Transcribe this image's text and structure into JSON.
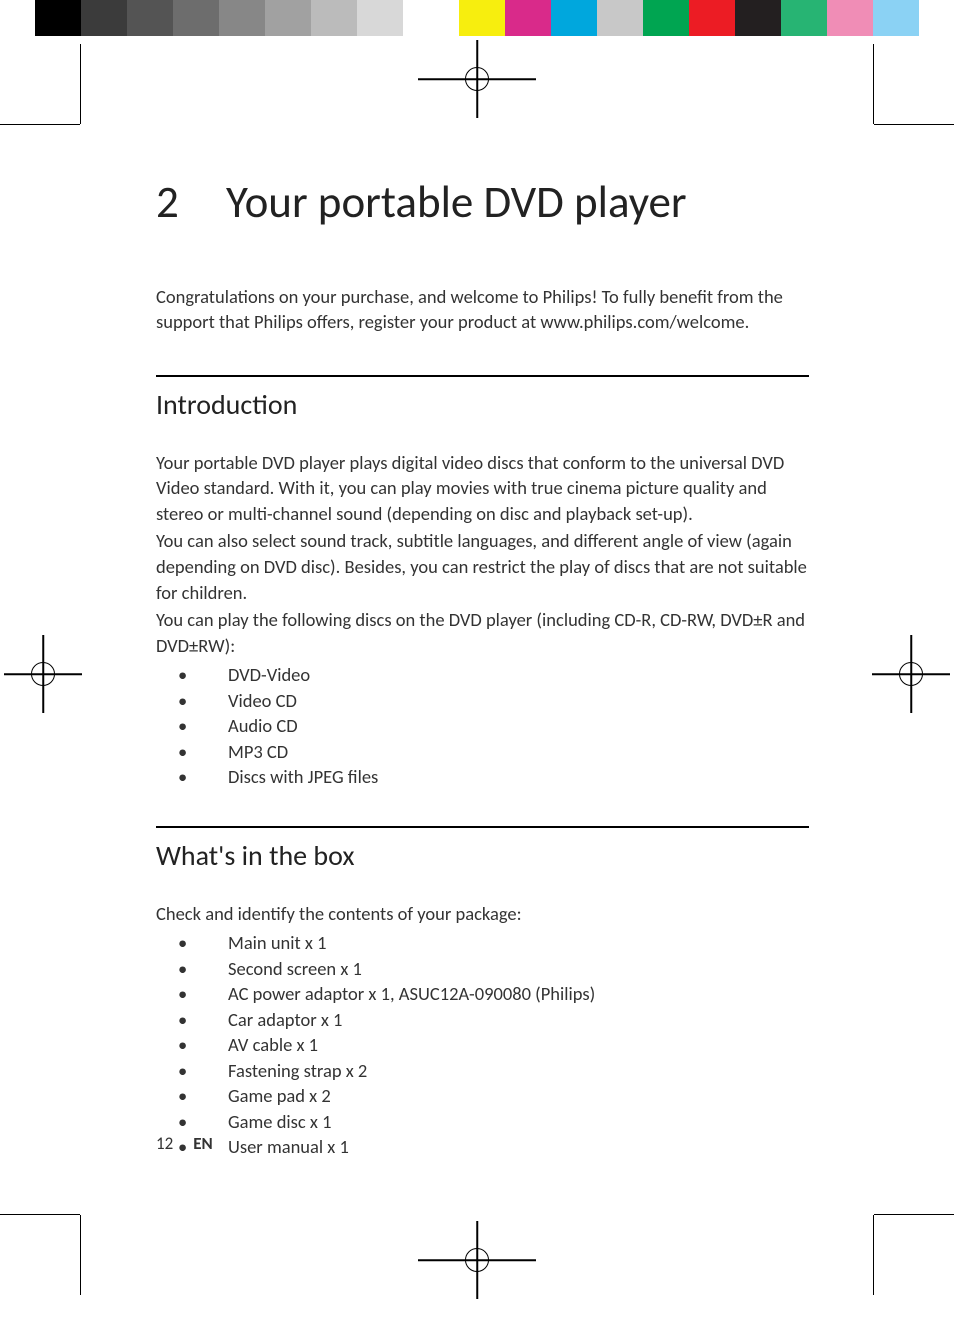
{
  "colorbars_left": [
    "#000000",
    "#3b3b3b",
    "#545454",
    "#6d6d6d",
    "#878787",
    "#a1a1a1",
    "#bbbbbb",
    "#d8d8d8",
    "#ffffff"
  ],
  "colorbars_right": [
    "#f7ee0e",
    "#d92a8a",
    "#00a7dd",
    "#c8c8c8",
    "#00a551",
    "#ec1c24",
    "#231f20",
    "#27b473",
    "#f08db6",
    "#8bd2f4"
  ],
  "chapter": {
    "number": "2",
    "title": "Your portable DVD player"
  },
  "intro": "Congratulations on your purchase, and welcome to Philips! To fully benefit from the support that Philips offers, register your product at www.philips.com/welcome.",
  "section1": {
    "heading": "Introduction",
    "para1": "Your portable DVD player plays digital video discs that conform to the universal DVD Video standard. With it, you can play movies with true cinema picture quality and stereo or multi-channel sound (depending on disc and playback set-up).",
    "para2": "You can also select sound track, subtitle languages, and different angle of view (again depending on DVD disc). Besides, you can restrict the play of discs that are not suitable for children.",
    "para3": "You can play the following discs on the DVD player (including CD-R, CD-RW, DVD±R and DVD±RW):",
    "bullets": [
      "DVD-Video",
      "Video CD",
      "Audio CD",
      "MP3 CD",
      "Discs with JPEG files"
    ]
  },
  "section2": {
    "heading": "What's in the box",
    "para": "Check and identify the contents of your package:",
    "bullets": [
      "Main unit x 1",
      "Second screen x 1",
      "AC power adaptor x 1, ASUC12A-090080 (Philips)",
      "Car adaptor x 1",
      "AV cable x 1",
      "Fastening strap x 2",
      "Game pad x 2",
      "Game disc x 1",
      "User manual x 1"
    ]
  },
  "footer": {
    "page": "12",
    "lang": "EN"
  }
}
